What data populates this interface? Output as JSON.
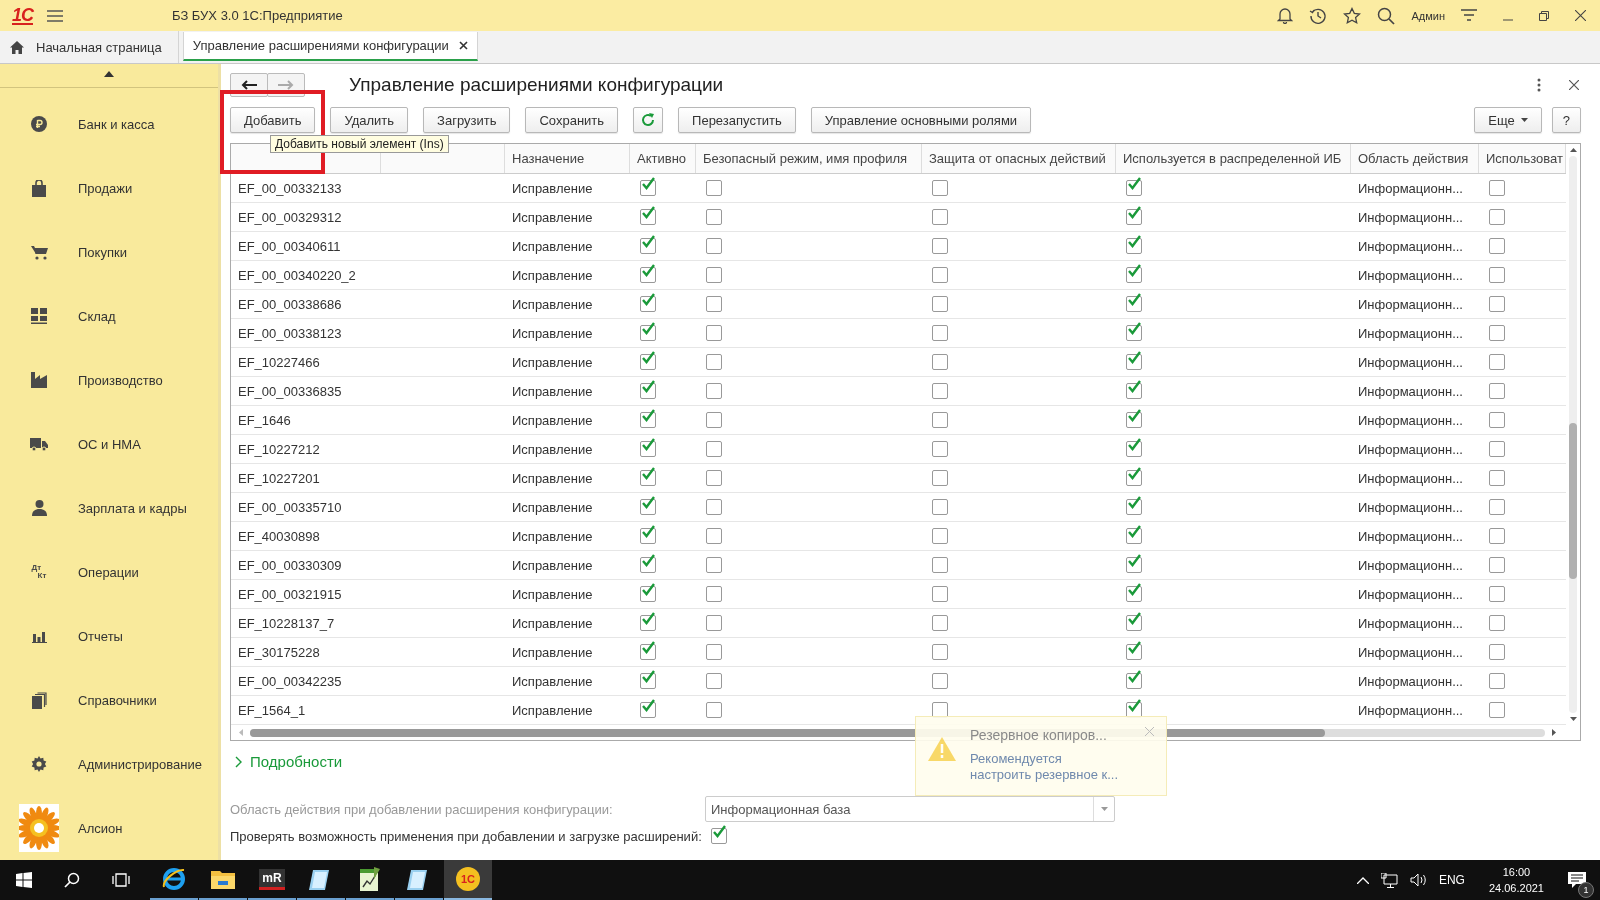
{
  "titlebar": {
    "logo": "1С",
    "title": "БЗ БУХ 3.0 1С:Предприятие",
    "user": "Админ"
  },
  "tabs": [
    {
      "label": "Начальная страница",
      "selected": false,
      "kind": "home"
    },
    {
      "label": "Управление расширениями конфигурации",
      "selected": true,
      "kind": "closable"
    }
  ],
  "sidebar": {
    "items": [
      {
        "label": "Банк и касса",
        "kind": "coin"
      },
      {
        "label": "Продажи",
        "kind": "bag"
      },
      {
        "label": "Покупки",
        "kind": "cart"
      },
      {
        "label": "Склад",
        "kind": "grid"
      },
      {
        "label": "Производство",
        "kind": "factory"
      },
      {
        "label": "ОС и НМА",
        "kind": "truck"
      },
      {
        "label": "Зарплата и кадры",
        "kind": "person"
      },
      {
        "label": "Операции",
        "kind": "dtkt",
        "icon_text": [
          "Дт",
          "Кт"
        ]
      },
      {
        "label": "Отчеты",
        "kind": "chart"
      },
      {
        "label": "Справочники",
        "kind": "books"
      },
      {
        "label": "Администрирование",
        "kind": "gear"
      },
      {
        "label": "Алсион",
        "kind": "logo"
      }
    ]
  },
  "form": {
    "title": "Управление расширениями конфигурации",
    "toolbar": [
      {
        "kind": "button",
        "label": "Добавить",
        "highlighted": true,
        "tooltip": "Добавить новый элемент (Ins)"
      },
      {
        "kind": "button",
        "label": "Удалить"
      },
      {
        "kind": "button",
        "label": "Загрузить"
      },
      {
        "kind": "button",
        "label": "Сохранить"
      },
      {
        "kind": "refresh"
      },
      {
        "kind": "button",
        "label": "Перезапустить"
      },
      {
        "kind": "button",
        "label": "Управление основными ролями"
      }
    ],
    "more_button": "Еще",
    "help_button": "?",
    "table": {
      "columns": [
        {},
        {},
        {
          "label": "Назначение"
        },
        {
          "label": "Активно"
        },
        {
          "label": "Безопасный режим, имя профиля"
        },
        {
          "label": "Защита от опасных действий"
        },
        {
          "label": "Используется в распределенной ИБ"
        },
        {
          "label": "Область действия"
        },
        {
          "label": "Использоват"
        }
      ],
      "rows": [
        {
          "name": "EF_00_00332133",
          "purpose": "Исправление",
          "active": true,
          "safe_mode": false,
          "protection": false,
          "distributed": true,
          "scope": "Информационн...",
          "column_9": false
        },
        {
          "name": "EF_00_00329312",
          "purpose": "Исправление",
          "active": true,
          "safe_mode": false,
          "protection": false,
          "distributed": true,
          "scope": "Информационн...",
          "column_9": false
        },
        {
          "name": "EF_00_00340611",
          "purpose": "Исправление",
          "active": true,
          "safe_mode": false,
          "protection": false,
          "distributed": true,
          "scope": "Информационн...",
          "column_9": false
        },
        {
          "name": "EF_00_00340220_2",
          "purpose": "Исправление",
          "active": true,
          "safe_mode": false,
          "protection": false,
          "distributed": true,
          "scope": "Информационн...",
          "column_9": false
        },
        {
          "name": "EF_00_00338686",
          "purpose": "Исправление",
          "active": true,
          "safe_mode": false,
          "protection": false,
          "distributed": true,
          "scope": "Информационн...",
          "column_9": false
        },
        {
          "name": "EF_00_00338123",
          "purpose": "Исправление",
          "active": true,
          "safe_mode": false,
          "protection": false,
          "distributed": true,
          "scope": "Информационн...",
          "column_9": false
        },
        {
          "name": "EF_10227466",
          "purpose": "Исправление",
          "active": true,
          "safe_mode": false,
          "protection": false,
          "distributed": true,
          "scope": "Информационн...",
          "column_9": false
        },
        {
          "name": "EF_00_00336835",
          "purpose": "Исправление",
          "active": true,
          "safe_mode": false,
          "protection": false,
          "distributed": true,
          "scope": "Информационн...",
          "column_9": false
        },
        {
          "name": "EF_1646",
          "purpose": "Исправление",
          "active": true,
          "safe_mode": false,
          "protection": false,
          "distributed": true,
          "scope": "Информационн...",
          "column_9": false
        },
        {
          "name": "EF_10227212",
          "purpose": "Исправление",
          "active": true,
          "safe_mode": false,
          "protection": false,
          "distributed": true,
          "scope": "Информационн...",
          "column_9": false
        },
        {
          "name": "EF_10227201",
          "purpose": "Исправление",
          "active": true,
          "safe_mode": false,
          "protection": false,
          "distributed": true,
          "scope": "Информационн...",
          "column_9": false
        },
        {
          "name": "EF_00_00335710",
          "purpose": "Исправление",
          "active": true,
          "safe_mode": false,
          "protection": false,
          "distributed": true,
          "scope": "Информационн...",
          "column_9": false
        },
        {
          "name": "EF_40030898",
          "purpose": "Исправление",
          "active": true,
          "safe_mode": false,
          "protection": false,
          "distributed": true,
          "scope": "Информационн...",
          "column_9": false
        },
        {
          "name": "EF_00_00330309",
          "purpose": "Исправление",
          "active": true,
          "safe_mode": false,
          "protection": false,
          "distributed": true,
          "scope": "Информационн...",
          "column_9": false
        },
        {
          "name": "EF_00_00321915",
          "purpose": "Исправление",
          "active": true,
          "safe_mode": false,
          "protection": false,
          "distributed": true,
          "scope": "Информационн...",
          "column_9": false
        },
        {
          "name": "EF_10228137_7",
          "purpose": "Исправление",
          "active": true,
          "safe_mode": false,
          "protection": false,
          "distributed": true,
          "scope": "Информационн...",
          "column_9": false
        },
        {
          "name": "EF_30175228",
          "purpose": "Исправление",
          "active": true,
          "safe_mode": false,
          "protection": false,
          "distributed": true,
          "scope": "Информационн...",
          "column_9": false
        },
        {
          "name": "EF_00_00342235",
          "purpose": "Исправление",
          "active": true,
          "safe_mode": false,
          "protection": false,
          "distributed": true,
          "scope": "Информационн...",
          "column_9": false
        },
        {
          "name": "EF_1564_1",
          "purpose": "Исправление",
          "active": true,
          "safe_mode": false,
          "protection": false,
          "distributed": true,
          "scope": "Информационн...",
          "column_9": false
        }
      ]
    },
    "details_link": "Подробности",
    "scope_field": {
      "label": "Область действия при добавлении расширения конфигурации:",
      "value": "Информационная база"
    },
    "check_field": {
      "label": "Проверять возможность применения при добавлении и загрузке расширений:",
      "checked": true
    }
  },
  "notification": {
    "title": "Резервное копиров...",
    "text": "Рекомендуется настроить резервное к..."
  },
  "taskbar": {
    "apps": [
      {
        "kind": "ie",
        "active": false
      },
      {
        "kind": "folder",
        "active": false
      },
      {
        "kind": "mr",
        "label": "mR",
        "active": false
      },
      {
        "kind": "notepad",
        "active": false
      },
      {
        "kind": "sheet",
        "active": false
      },
      {
        "kind": "notepad",
        "active": false
      },
      {
        "kind": "onec",
        "label": "1С",
        "active": true
      }
    ],
    "language": "ENG",
    "time": "16:00",
    "date": "24.06.2021",
    "notification_count": "1"
  }
}
